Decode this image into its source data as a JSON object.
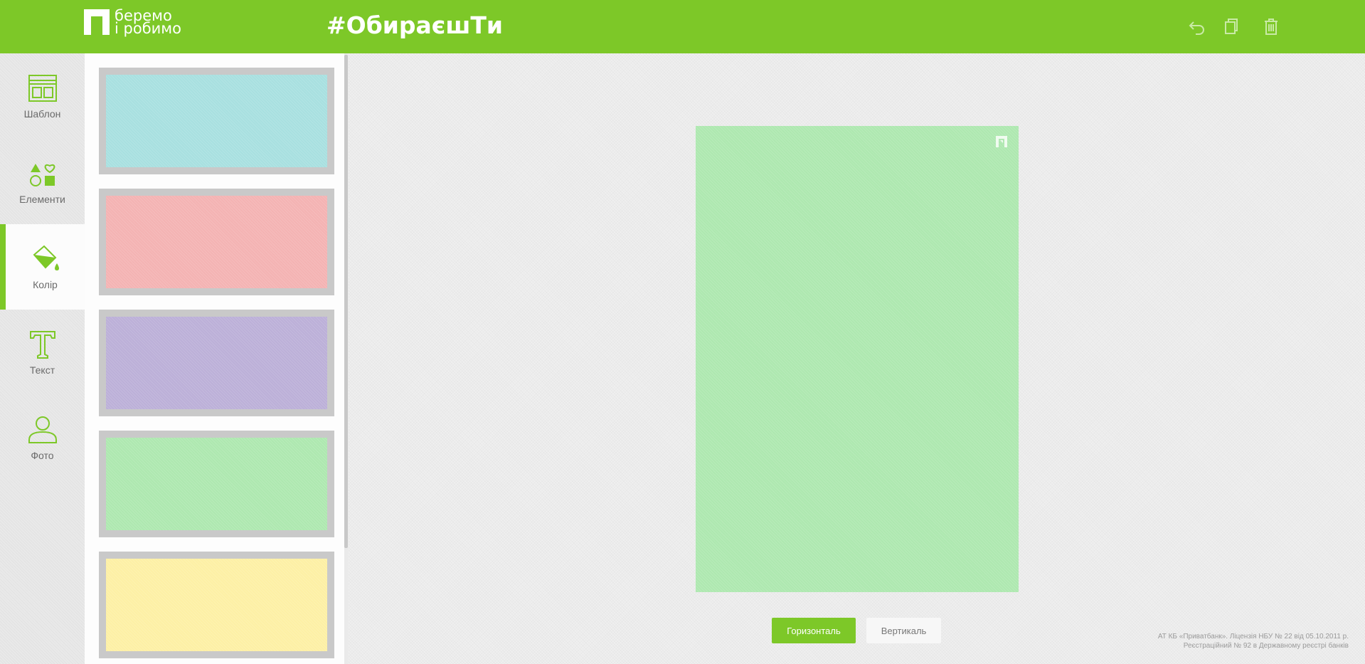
{
  "header": {
    "logo_line1": "беремо",
    "logo_line2": "і робимо",
    "hashtag": "#ОбираєшТи",
    "actions": [
      {
        "name": "undo-icon"
      },
      {
        "name": "copy-icon"
      },
      {
        "name": "trash-icon"
      }
    ]
  },
  "sidebar": {
    "items": [
      {
        "label": "Шаблон",
        "icon": "template-icon",
        "active": false
      },
      {
        "label": "Елементи",
        "icon": "shapes-icon",
        "active": false
      },
      {
        "label": "Колір",
        "icon": "paint-bucket-icon",
        "active": true
      },
      {
        "label": "Текст",
        "icon": "text-icon",
        "active": false
      },
      {
        "label": "Фото",
        "icon": "user-icon",
        "active": false
      }
    ]
  },
  "swatches": [
    "#a8e0e0",
    "#f4b3b3",
    "#bcb0d8",
    "#aee8b0",
    "#fdf0a5"
  ],
  "canvas": {
    "background": "#aee8b0"
  },
  "orientation": {
    "horizontal_label": "Горизонталь",
    "vertical_label": "Вертикаль",
    "selected": "horizontal"
  },
  "footer": {
    "line1": "АТ КБ «Приватбанк». Ліцензія НБУ № 22 від 05.10.2011 р.",
    "line2": "Реєстраційний № 92 в Державному реєстрі банків"
  },
  "colors": {
    "brand": "#7dc828",
    "accent_text": "#ffffff"
  }
}
